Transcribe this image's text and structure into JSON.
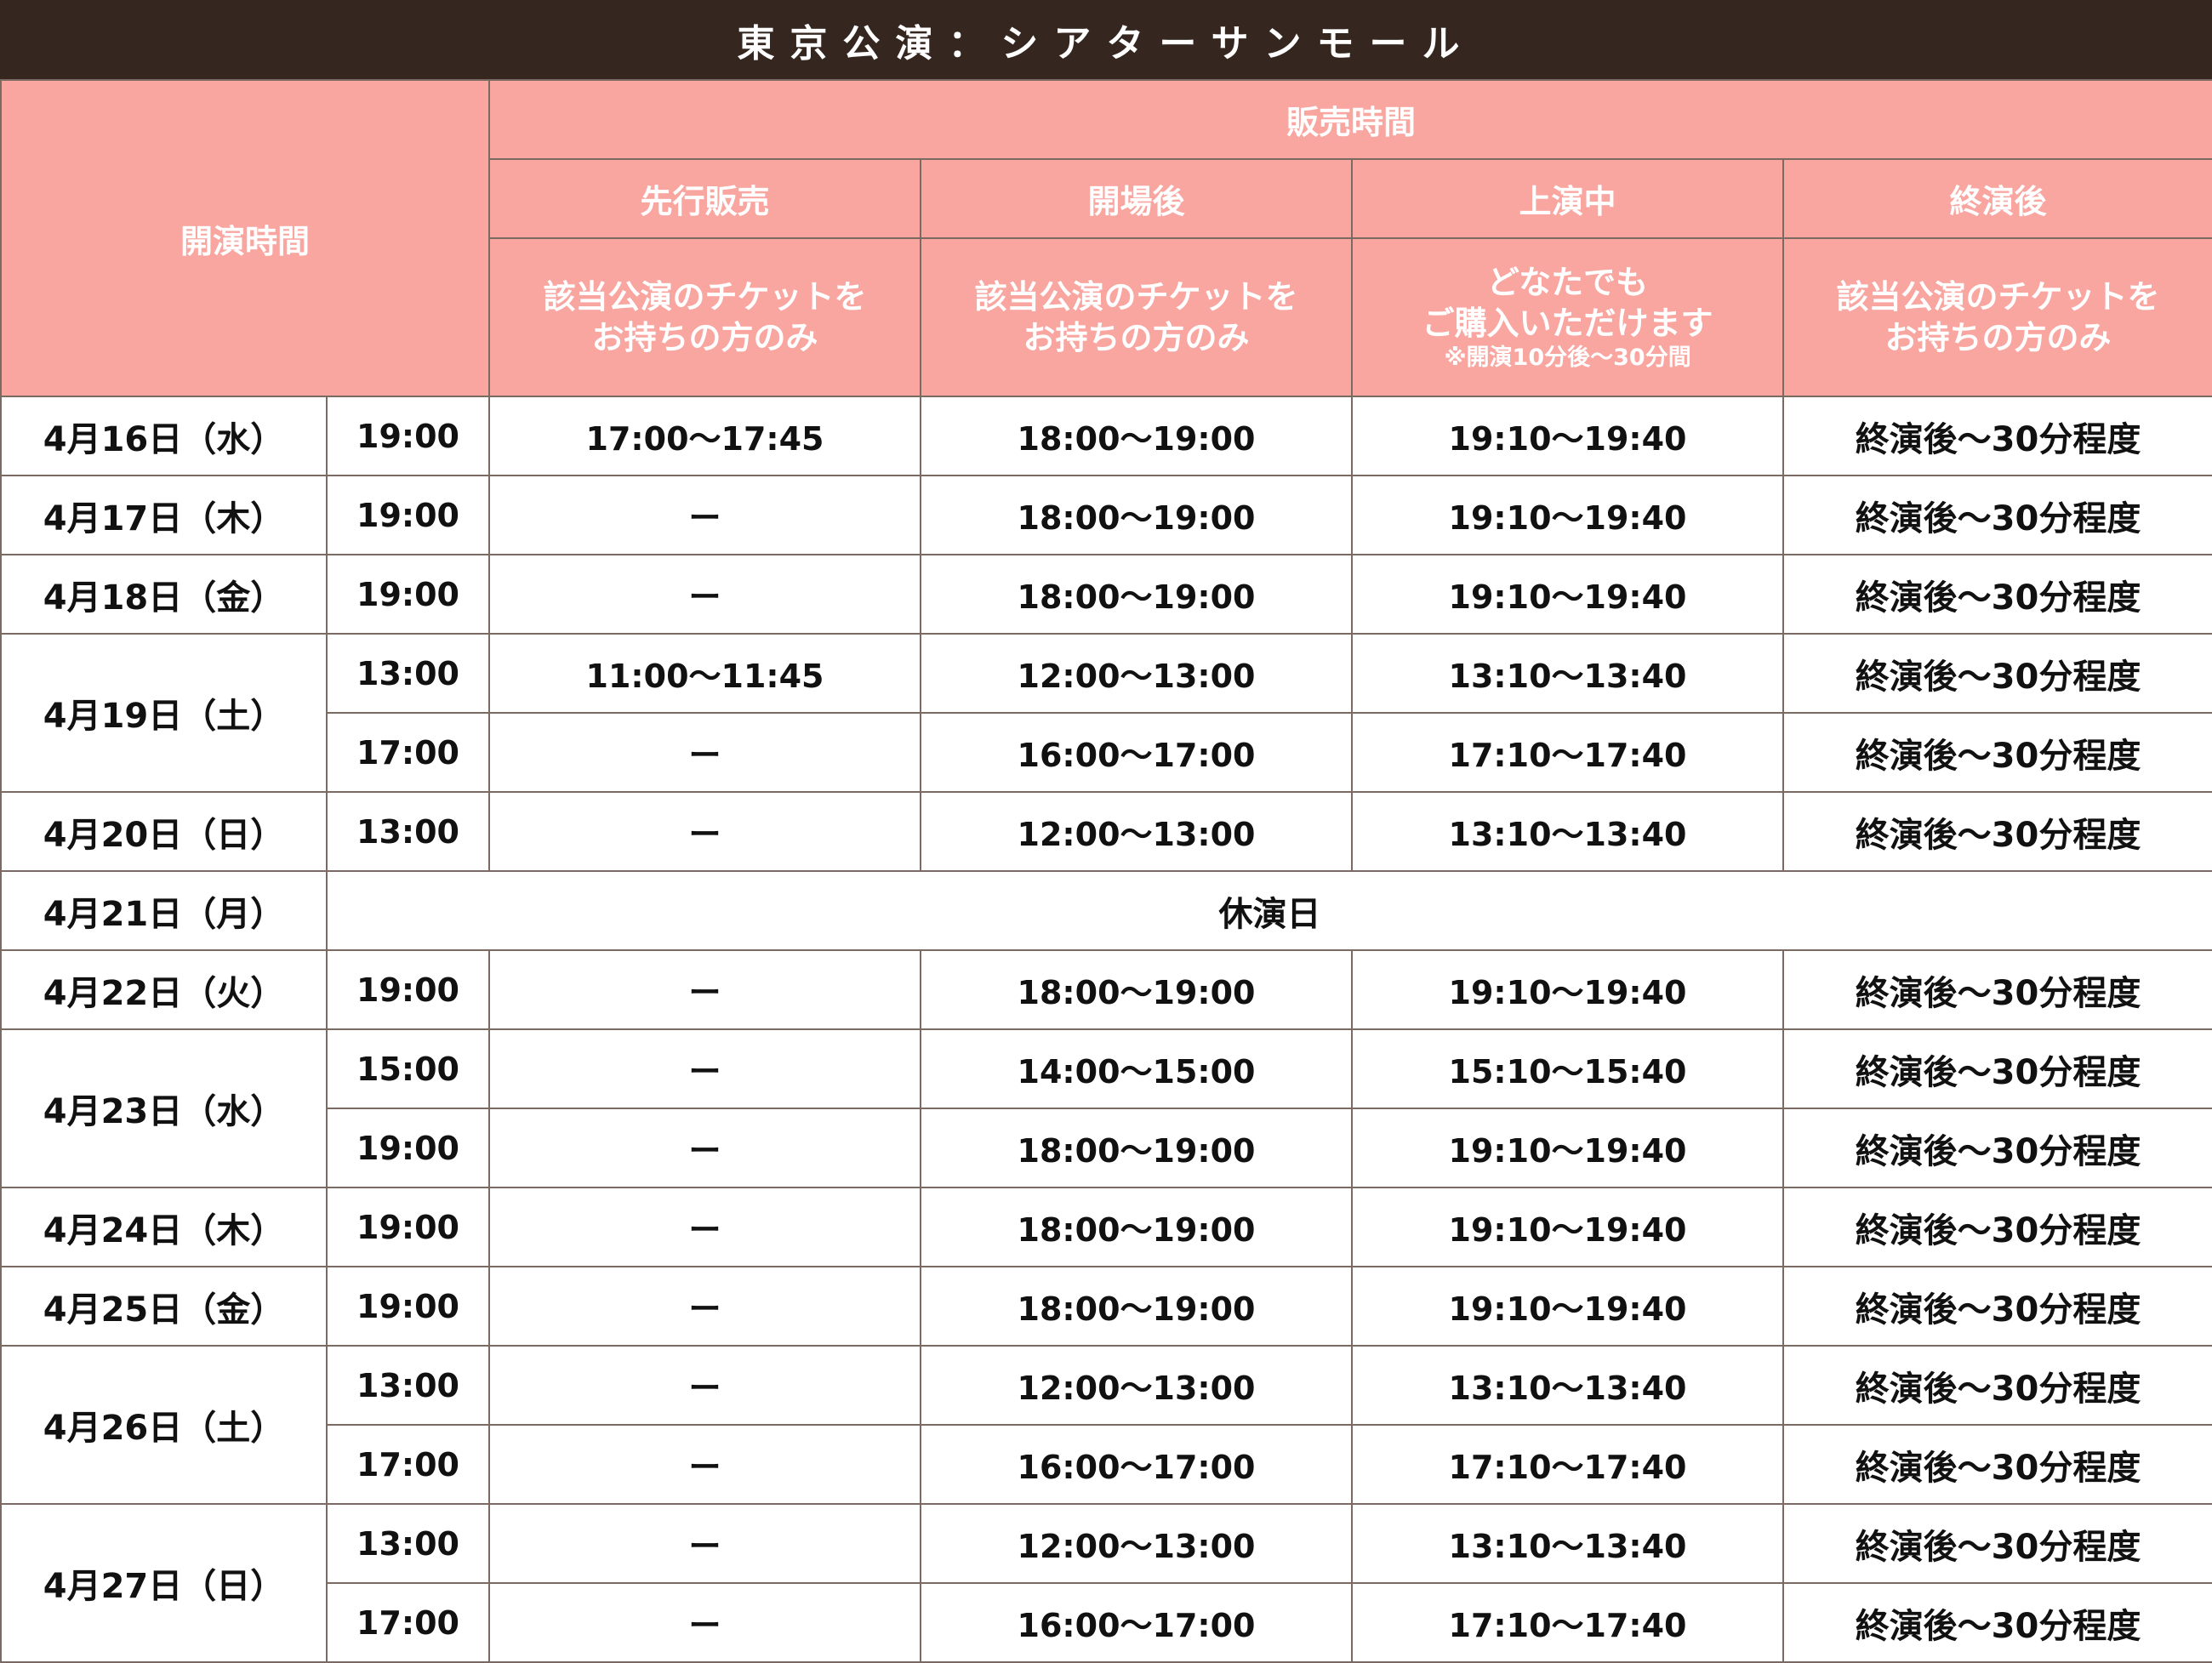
{
  "title": "東京公演：シアターサンモール",
  "header": {
    "start_time_label": "開演時間",
    "sales_time_label": "販売時間",
    "columns": [
      {
        "label": "先行販売",
        "note_lines": [
          "該当公演のチケットを",
          "お持ちの方のみ"
        ],
        "sub": ""
      },
      {
        "label": "開場後",
        "note_lines": [
          "該当公演のチケットを",
          "お持ちの方のみ"
        ],
        "sub": ""
      },
      {
        "label": "上演中",
        "note_lines": [
          "どなたでも",
          "ご購入いただけます"
        ],
        "sub": "※開演10分後〜30分間"
      },
      {
        "label": "終演後",
        "note_lines": [
          "該当公演のチケットを",
          "お持ちの方のみ"
        ],
        "sub": ""
      }
    ]
  },
  "days": [
    {
      "date": "4月16日（水）",
      "shows": [
        {
          "time": "19:00",
          "pre": "17:00〜17:45",
          "open": "18:00〜19:00",
          "during": "19:10〜19:40",
          "after": "終演後〜30分程度"
        }
      ]
    },
    {
      "date": "4月17日（木）",
      "shows": [
        {
          "time": "19:00",
          "pre": "ー",
          "open": "18:00〜19:00",
          "during": "19:10〜19:40",
          "after": "終演後〜30分程度"
        }
      ]
    },
    {
      "date": "4月18日（金）",
      "shows": [
        {
          "time": "19:00",
          "pre": "ー",
          "open": "18:00〜19:00",
          "during": "19:10〜19:40",
          "after": "終演後〜30分程度"
        }
      ]
    },
    {
      "date": "4月19日（土）",
      "shows": [
        {
          "time": "13:00",
          "pre": "11:00〜11:45",
          "open": "12:00〜13:00",
          "during": "13:10〜13:40",
          "after": "終演後〜30分程度"
        },
        {
          "time": "17:00",
          "pre": "ー",
          "open": "16:00〜17:00",
          "during": "17:10〜17:40",
          "after": "終演後〜30分程度"
        }
      ]
    },
    {
      "date": "4月20日（日）",
      "shows": [
        {
          "time": "13:00",
          "pre": "ー",
          "open": "12:00〜13:00",
          "during": "13:10〜13:40",
          "after": "終演後〜30分程度"
        }
      ]
    },
    {
      "date": "4月21日（月）",
      "closed": "休演日",
      "shows": []
    },
    {
      "date": "4月22日（火）",
      "shows": [
        {
          "time": "19:00",
          "pre": "ー",
          "open": "18:00〜19:00",
          "during": "19:10〜19:40",
          "after": "終演後〜30分程度"
        }
      ]
    },
    {
      "date": "4月23日（水）",
      "shows": [
        {
          "time": "15:00",
          "pre": "ー",
          "open": "14:00〜15:00",
          "during": "15:10〜15:40",
          "after": "終演後〜30分程度"
        },
        {
          "time": "19:00",
          "pre": "ー",
          "open": "18:00〜19:00",
          "during": "19:10〜19:40",
          "after": "終演後〜30分程度"
        }
      ]
    },
    {
      "date": "4月24日（木）",
      "shows": [
        {
          "time": "19:00",
          "pre": "ー",
          "open": "18:00〜19:00",
          "during": "19:10〜19:40",
          "after": "終演後〜30分程度"
        }
      ]
    },
    {
      "date": "4月25日（金）",
      "shows": [
        {
          "time": "19:00",
          "pre": "ー",
          "open": "18:00〜19:00",
          "during": "19:10〜19:40",
          "after": "終演後〜30分程度"
        }
      ]
    },
    {
      "date": "4月26日（土）",
      "shows": [
        {
          "time": "13:00",
          "pre": "ー",
          "open": "12:00〜13:00",
          "during": "13:10〜13:40",
          "after": "終演後〜30分程度"
        },
        {
          "time": "17:00",
          "pre": "ー",
          "open": "16:00〜17:00",
          "during": "17:10〜17:40",
          "after": "終演後〜30分程度"
        }
      ]
    },
    {
      "date": "4月27日（日）",
      "shows": [
        {
          "time": "13:00",
          "pre": "ー",
          "open": "12:00〜13:00",
          "during": "13:10〜13:40",
          "after": "終演後〜30分程度"
        },
        {
          "time": "17:00",
          "pre": "ー",
          "open": "16:00〜17:00",
          "during": "17:10〜17:40",
          "after": "終演後〜30分程度"
        }
      ]
    }
  ],
  "colors": {
    "title_bg": "#35271f",
    "header_bg": "#f9a5a0",
    "border": "#7a6a62"
  }
}
